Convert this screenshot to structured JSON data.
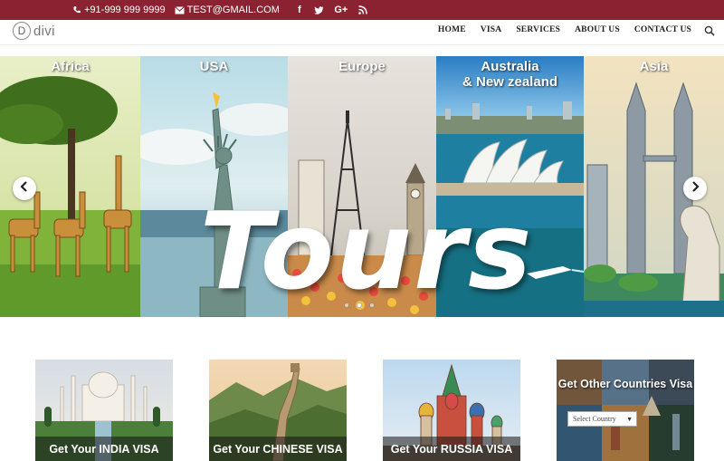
{
  "topbar": {
    "phone": "+91-999 999 9999",
    "email": "TEST@GMAIL.COM",
    "social": [
      "facebook-icon",
      "twitter-icon",
      "google-plus-icon",
      "rss-icon"
    ],
    "google_plus_label": "G+"
  },
  "header": {
    "logo_mark": "D",
    "logo_text": "divi",
    "nav": [
      "HOME",
      "VISA",
      "SERVICES",
      "ABOUT US",
      "CONTACT US"
    ]
  },
  "slider": {
    "panels": [
      "Africa",
      "USA",
      "Europe",
      "Australia\n& New zealand",
      "Asia"
    ],
    "headline": "Tours",
    "dot_count": 3,
    "active_dot": 2
  },
  "cards": [
    {
      "label": "Get Your INDIA VISA"
    },
    {
      "label": "Get Your CHINESE VISA"
    },
    {
      "label": "Get Your RUSSIA VISA"
    }
  ],
  "other": {
    "title": "Get Other Countries Visa",
    "select_value": "Select Country"
  },
  "colors": {
    "topbar": "#8b2232",
    "nav_text": "#222222"
  }
}
